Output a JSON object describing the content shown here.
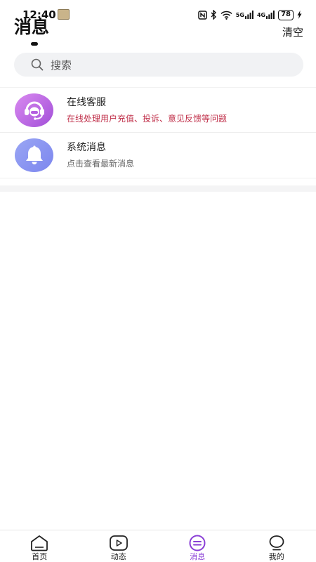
{
  "status_bar": {
    "time": "12:40",
    "network": "5G",
    "network2": "4G",
    "battery": "78"
  },
  "header": {
    "title": "消息",
    "clear_label": "清空"
  },
  "search": {
    "placeholder": "搜索"
  },
  "messages": [
    {
      "title": "在线客服",
      "subtitle": "在线处理用户充值、投诉、意见反馈等问题",
      "icon": "headset-icon"
    },
    {
      "title": "系统消息",
      "subtitle": "点击查看最新消息",
      "icon": "bell-icon"
    }
  ],
  "tabs": [
    {
      "label": "首页",
      "icon": "home-icon",
      "active": false
    },
    {
      "label": "动态",
      "icon": "play-icon",
      "active": false
    },
    {
      "label": "消息",
      "icon": "message-icon",
      "active": true
    },
    {
      "label": "我的",
      "icon": "profile-icon",
      "active": false
    }
  ],
  "colors": {
    "accent": "#8a3fd6",
    "alert_text": "#c0304a",
    "service_avatar": "#b45ee0",
    "system_avatar": "#838ef0"
  }
}
